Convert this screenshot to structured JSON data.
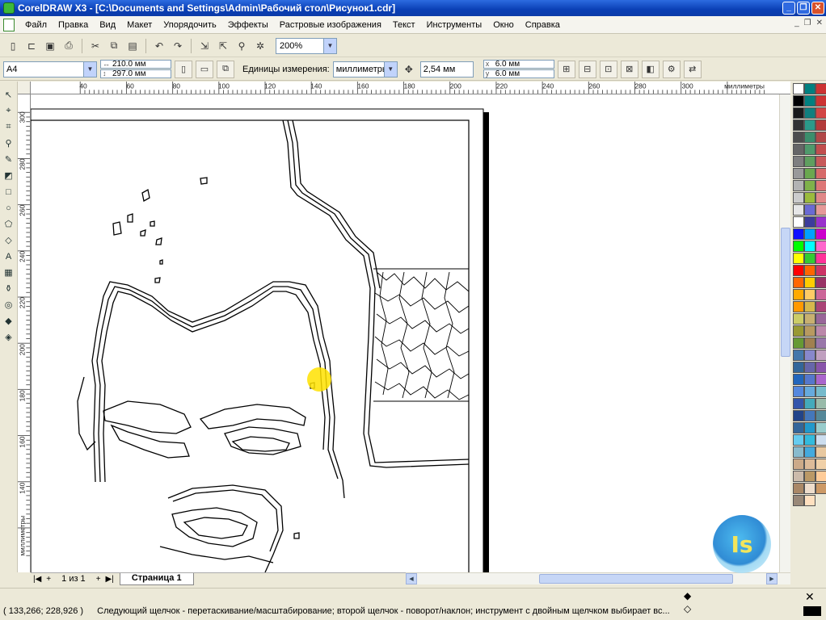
{
  "window": {
    "title": "CorelDRAW X3 - [C:\\Documents and Settings\\Admin\\Рабочий стол\\Рисунок1.cdr]",
    "buttons": {
      "minimize": "_",
      "restore": "❐",
      "close": "✕"
    }
  },
  "menu": {
    "items": [
      "Файл",
      "Правка",
      "Вид",
      "Макет",
      "Упорядочить",
      "Эффекты",
      "Растровые изображения",
      "Текст",
      "Инструменты",
      "Окно",
      "Справка"
    ],
    "mdi_buttons": [
      "_",
      "❐",
      "✕"
    ]
  },
  "toolbar": {
    "zoom": "200%"
  },
  "property_bar": {
    "paper_size": "A4",
    "width": "210.0 мм",
    "height": "297.0 мм",
    "units_label": "Единицы измерения:",
    "units_value": "миллиметры",
    "nudge": "2,54 мм",
    "duplicate_x": "6.0 мм",
    "duplicate_y": "6.0 мм"
  },
  "rulers": {
    "top_ticks": [
      "40",
      "60",
      "80",
      "100",
      "120",
      "140",
      "160",
      "180",
      "200",
      "220",
      "240",
      "260",
      "280",
      "300"
    ],
    "top_unit": "миллиметры",
    "left_ticks": [
      "300",
      "280",
      "260",
      "240",
      "220",
      "200",
      "180",
      "160",
      "140"
    ],
    "left_unit": "миллиметры"
  },
  "page_nav": {
    "first": "|◀",
    "add_before": "+",
    "count": "1 из 1",
    "add_after": "+",
    "last": "▶|",
    "page_tab": "Страница 1"
  },
  "status": {
    "coords": "( 133,266; 228,926 )",
    "hint": "Следующий щелчок - перетаскивание/масштабирование; второй щелчок - поворот/наклон; инструмент с двойным щелчком выбирает вс..."
  },
  "watermark": "Is",
  "palette": [
    "#ffffff",
    "#008080",
    "#cc3333",
    "#000000",
    "#008080",
    "#cc3333",
    "#1a1a1a",
    "#107f7f",
    "#d24545",
    "#333333",
    "#2a9a8a",
    "#b33b3b",
    "#4d4d4d",
    "#3b8e6c",
    "#b04848",
    "#666666",
    "#4f9a6c",
    "#c14e4e",
    "#7f7f7f",
    "#5f9f5f",
    "#c75a5a",
    "#999999",
    "#6aa84f",
    "#d66a6a",
    "#b3b3b3",
    "#7fb24a",
    "#dd7777",
    "#cccccc",
    "#9bbb3c",
    "#e08888",
    "#e6e6e6",
    "#6a6ad4",
    "#e59999",
    "#ffffff",
    "#3c3c9c",
    "#9933cc",
    "#1010ff",
    "#00a0ff",
    "#cc00cc",
    "#00ff00",
    "#00ffff",
    "#ff66cc",
    "#ffff00",
    "#33cc33",
    "#ff3399",
    "#ff0000",
    "#ff6600",
    "#cc3366",
    "#ff6600",
    "#ffcc00",
    "#993366",
    "#ffaa00",
    "#ffcc66",
    "#cc6699",
    "#ff9900",
    "#d6b84c",
    "#aa4477",
    "#cccc66",
    "#c8b070",
    "#996699",
    "#999933",
    "#b89a60",
    "#bb88aa",
    "#669933",
    "#a08050",
    "#9977aa",
    "#4477aa",
    "#8888cc",
    "#c0a0c0",
    "#336699",
    "#6666aa",
    "#8855aa",
    "#2266bb",
    "#5577cc",
    "#aa66cc",
    "#5588dd",
    "#66aadd",
    "#77bbcc",
    "#3355aa",
    "#44aabb",
    "#99bbaa",
    "#224488",
    "#4477bb",
    "#558899",
    "#336699",
    "#2299cc",
    "#99cccc",
    "#66ccee",
    "#33bbdd",
    "#ccddee",
    "#88bbcc",
    "#44aadd",
    "#e8c8a0",
    "#ccaa88",
    "#ddbb99",
    "#f0d0a8",
    "#ccbbaa",
    "#bb9966",
    "#ffcc99",
    "#aa8866",
    "#eeddcc",
    "#cc9966",
    "#998877",
    "#ffe0c0"
  ]
}
